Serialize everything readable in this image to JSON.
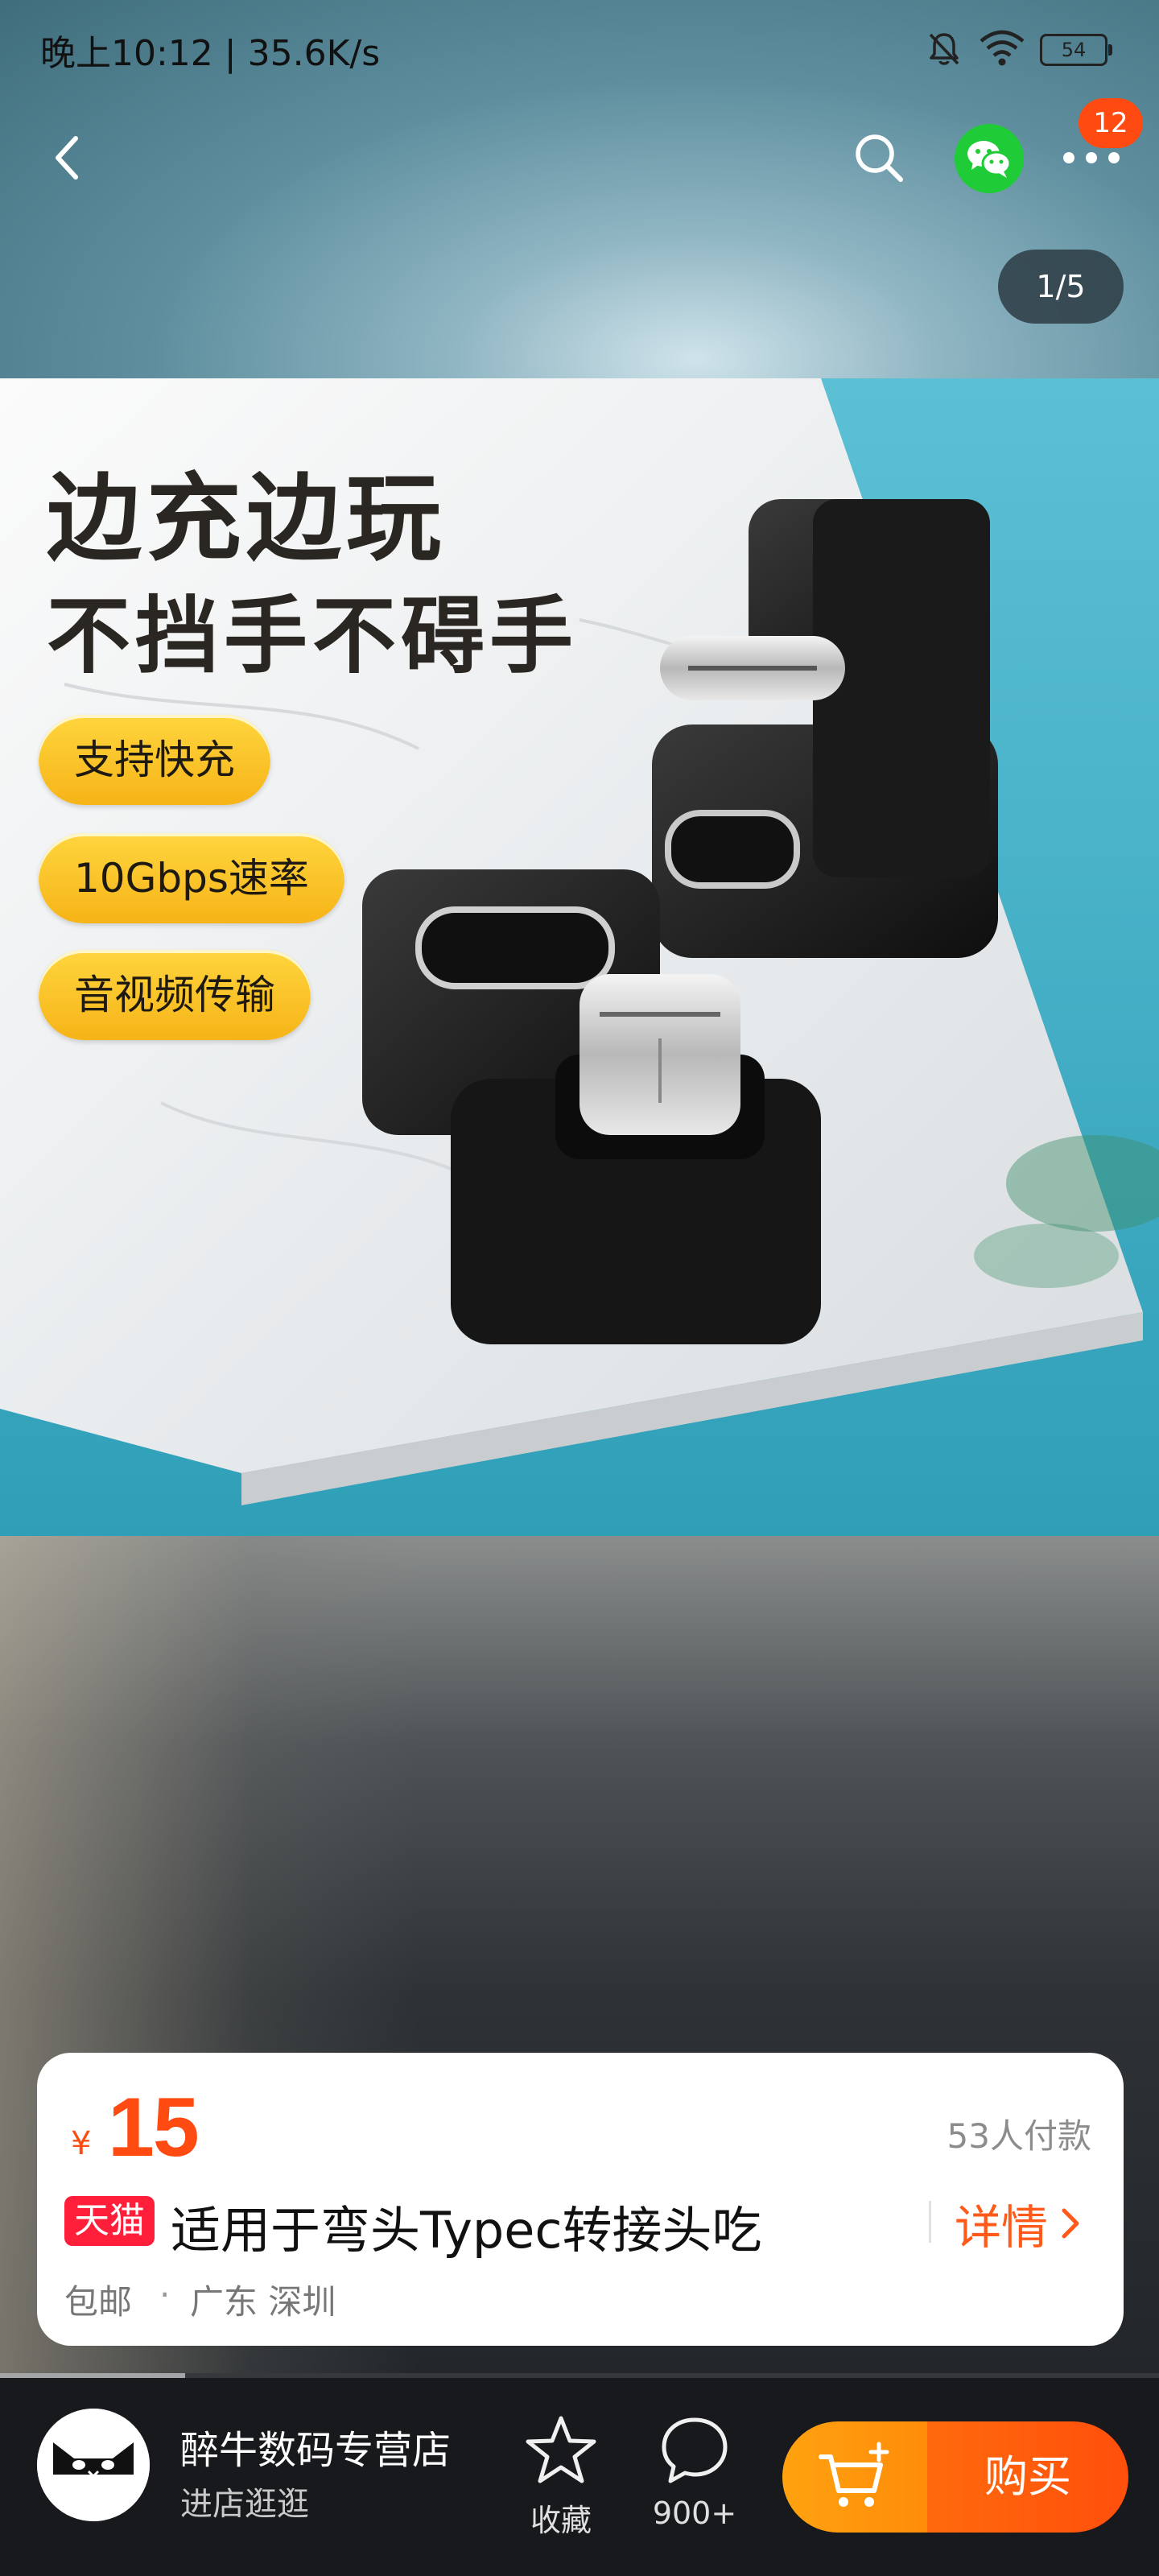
{
  "status_bar": {
    "time": "晚上10:12 | 35.6K/s",
    "battery": "54",
    "icons": [
      "mute-bell-icon",
      "wifi-icon",
      "battery-icon"
    ]
  },
  "nav": {
    "icons": [
      "back-arrow-icon",
      "search-icon",
      "wechat-icon",
      "more-dots-icon"
    ],
    "more_badge": "12",
    "image_counter": "1/5"
  },
  "product_image": {
    "headline_1": "边充边玩",
    "headline_2": "不挡手不碍手",
    "features": [
      "支持快充",
      "10Gbps速率",
      "音视频传输"
    ]
  },
  "info_card": {
    "price_symbol": "¥",
    "price": "15",
    "sales": "53人付款",
    "platform_badge": "天猫",
    "title": "适用于弯头Typec转接头吃",
    "details_label": "详情",
    "shipping": "包邮",
    "separator": "·",
    "location": "广东 深圳"
  },
  "bottom_bar": {
    "shop_name": "醉牛数码专营店",
    "shop_link": "进店逛逛",
    "favorite_label": "收藏",
    "comments_label": "900+",
    "buy_label": "购买"
  },
  "colors": {
    "accent": "#ff4a12",
    "tmall_red": "#ff1f3b",
    "cart_orange": "#ffa20f",
    "wechat_green": "#1fcc38"
  }
}
